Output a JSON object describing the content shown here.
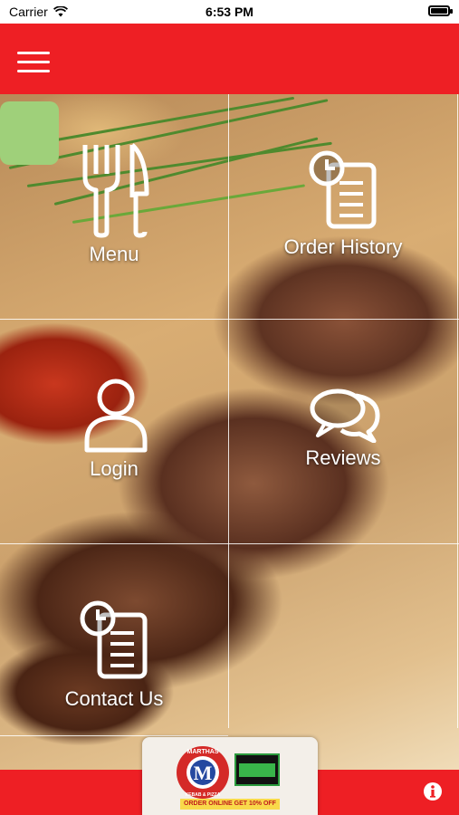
{
  "status_bar": {
    "carrier": "Carrier",
    "time": "6:53 PM"
  },
  "header": {
    "menu_icon": "hamburger-menu-icon"
  },
  "tiles": [
    {
      "label": "Menu",
      "icon": "fork-knife-icon"
    },
    {
      "label": "Order History",
      "icon": "clock-document-icon"
    },
    {
      "label": "Login",
      "icon": "user-icon"
    },
    {
      "label": "Reviews",
      "icon": "chat-bubbles-icon"
    },
    {
      "label": "Contact Us",
      "icon": "clock-document-icon"
    }
  ],
  "badge": {
    "logo_initial": "M",
    "logo_name": "MARTHAS",
    "logo_subtitle": "KEBAB & PIZZA",
    "promo": "ORDER ONLINE GET 10% OFF"
  },
  "footer": {
    "info_icon": "info-icon"
  },
  "colors": {
    "brand_red": "#ee1f24",
    "white": "#ffffff"
  }
}
